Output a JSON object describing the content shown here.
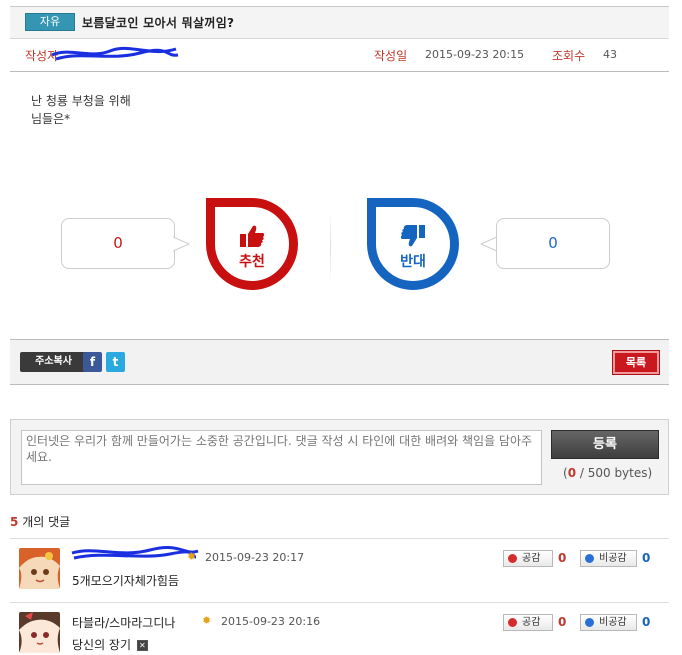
{
  "post": {
    "category": "자유",
    "title": "보름달코인 모아서 뭐살꺼임?",
    "author_label": "작성자",
    "date_label": "작성일",
    "date": "2015-09-23 20:15",
    "views_label": "조회수",
    "views": "43",
    "body_lines": [
      "난 청룡 부청을 위해",
      "님들은*"
    ]
  },
  "vote": {
    "up_count": "0",
    "up_label": "추천",
    "down_count": "0",
    "down_label": "반대"
  },
  "actions": {
    "copy_url": "주소복사",
    "facebook": "f",
    "twitter": "t",
    "list": "목록"
  },
  "comment_form": {
    "placeholder": "인터넷은 우리가 함께 만들어가는 소중한 공간입니다. 댓글 작성 시 타인에 대한 배려와 책임을 담아주세요.",
    "submit": "등록",
    "bytes_open": "(",
    "bytes_current": "0",
    "bytes_rest": " / 500 bytes)"
  },
  "comments_header": {
    "count": "5",
    "suffix": "개의 댓글"
  },
  "comments": [
    {
      "name": "",
      "time": "2015-09-23 20:17",
      "text": "5개모으기자체가힘듬",
      "like_label": "공감",
      "likes": "0",
      "dislike_label": "비공감",
      "dislikes": "0"
    },
    {
      "name": "타블라/스마라그디나",
      "time": "2015-09-23 20:16",
      "text": "당신의 장기",
      "like_label": "공감",
      "likes": "0",
      "dislike_label": "비공감",
      "dislikes": "0"
    }
  ],
  "icons": {
    "thumb_up": "thumbs-up-icon",
    "thumb_down": "thumbs-down-icon",
    "sun": "sun-icon",
    "like_dot": "smile-icon",
    "dislike_dot": "frown-icon",
    "broken_image": "broken-image-icon"
  },
  "colors": {
    "accent_red": "#c81010",
    "accent_blue": "#1565c0",
    "category_badge": "#3596b4"
  }
}
